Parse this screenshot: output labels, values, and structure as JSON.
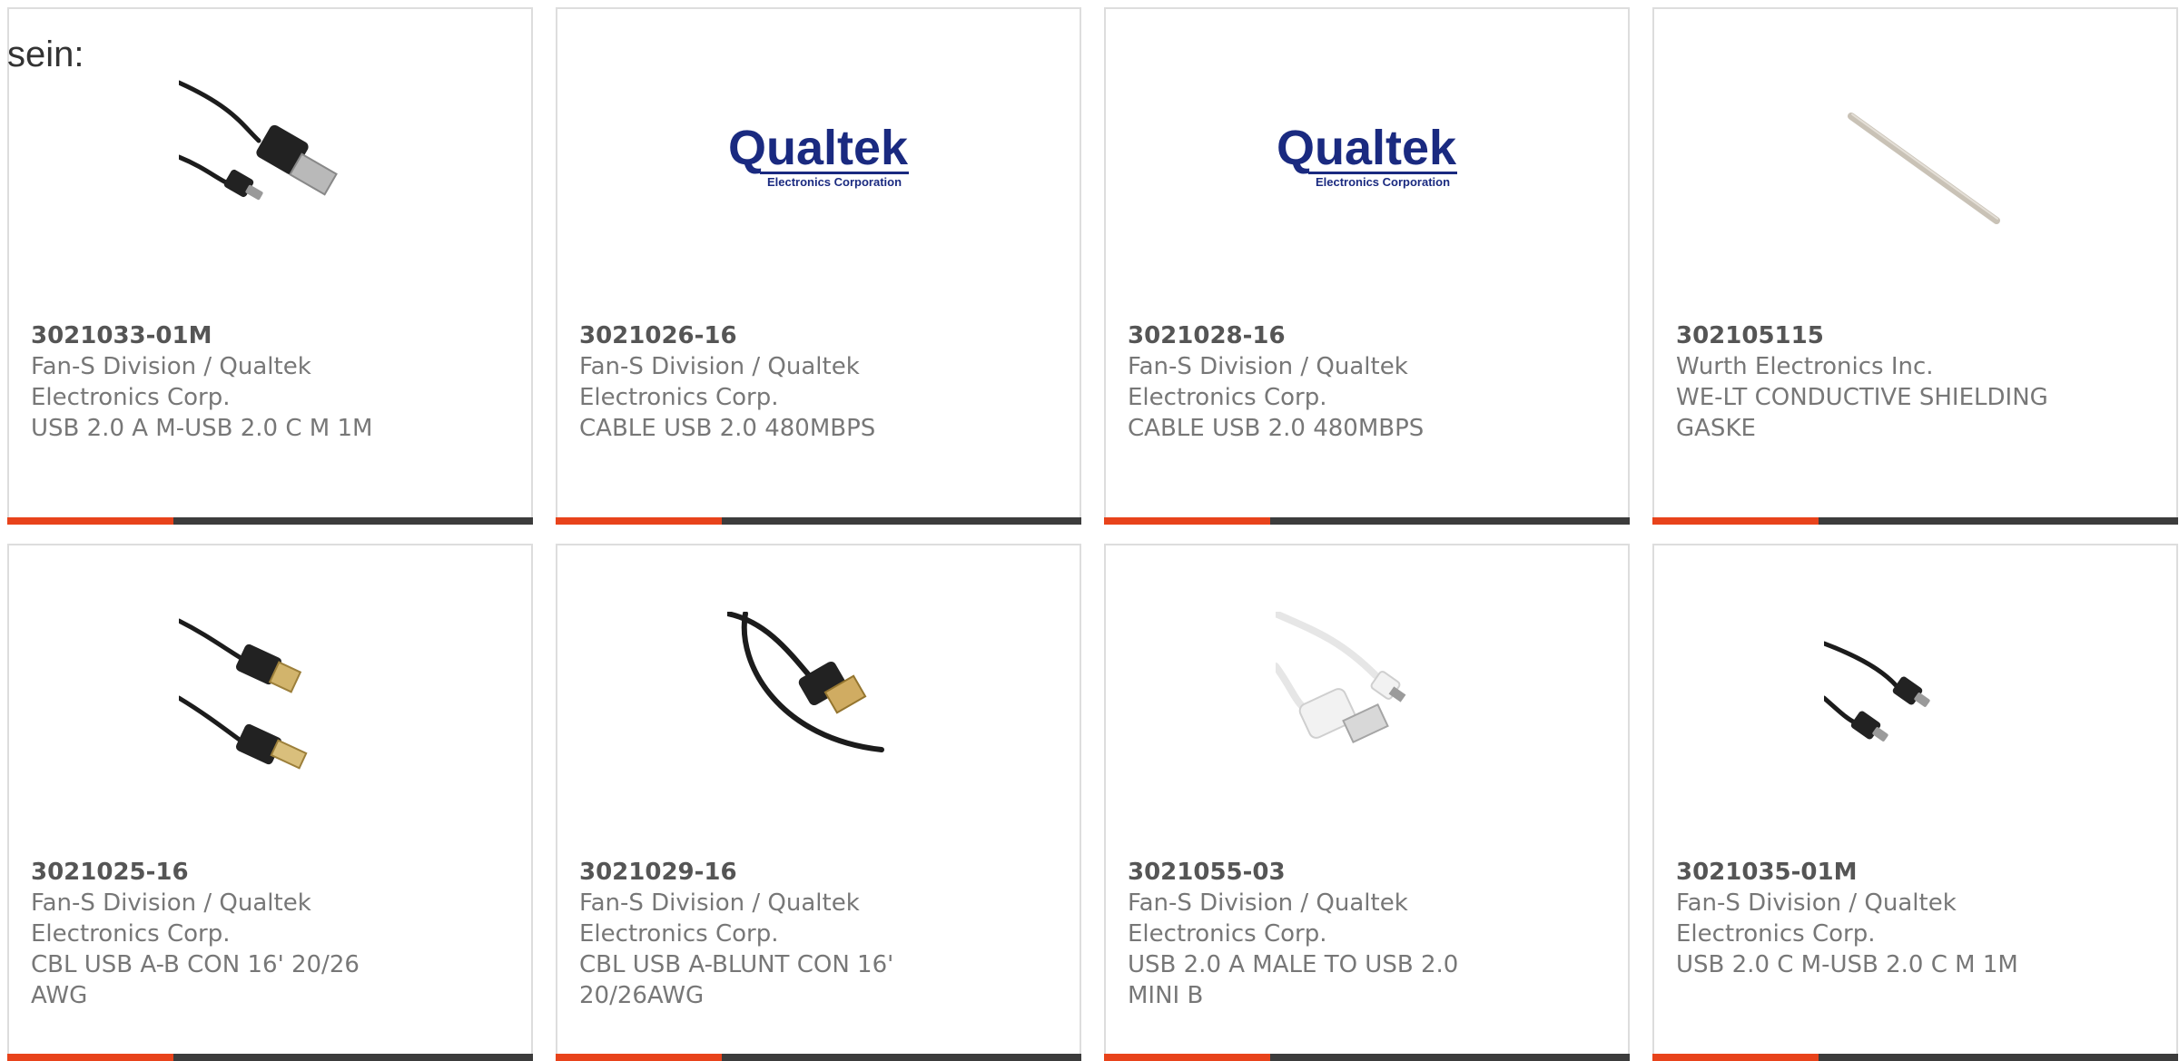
{
  "intro_text": "sein:",
  "products": [
    {
      "part_number": "3021033-01M",
      "manufacturer": "Fan-S Division / Qualtek Electronics Corp.",
      "description": "USB 2.0 A M-USB 2.0 C M 1M",
      "image": "usb-a-to-usb-c-cable-icon"
    },
    {
      "part_number": "3021026-16",
      "manufacturer": "Fan-S Division / Qualtek Electronics Corp.",
      "description": "CABLE USB 2.0 480MBPS",
      "image": "qualtek-logo",
      "logo": {
        "name": "Qualtek",
        "tagline": "Electronics Corporation"
      }
    },
    {
      "part_number": "3021028-16",
      "manufacturer": "Fan-S Division / Qualtek Electronics Corp.",
      "description": "CABLE USB 2.0 480MBPS",
      "image": "qualtek-logo",
      "logo": {
        "name": "Qualtek",
        "tagline": "Electronics Corporation"
      }
    },
    {
      "part_number": "302105115",
      "manufacturer": "Wurth Electronics Inc.",
      "description": "WE-LT CONDUCTIVE SHIELDING GASKE",
      "image": "shielding-gasket-strip-icon"
    },
    {
      "part_number": "3021025-16",
      "manufacturer": "Fan-S Division / Qualtek Electronics Corp.",
      "description": "CBL USB A-B CON 16' 20/26 AWG",
      "image": "usb-a-to-usb-b-cable-icon"
    },
    {
      "part_number": "3021029-16",
      "manufacturer": "Fan-S Division / Qualtek Electronics Corp.",
      "description": "CBL USB A-BLUNT CON 16' 20/26AWG",
      "image": "usb-a-blunt-cable-icon"
    },
    {
      "part_number": "3021055-03",
      "manufacturer": "Fan-S Division / Qualtek Electronics Corp.",
      "description": "USB 2.0 A MALE TO USB 2.0 MINI B",
      "image": "usb-a-to-mini-b-cable-icon"
    },
    {
      "part_number": "3021035-01M",
      "manufacturer": "Fan-S Division / Qualtek Electronics Corp.",
      "description": "USB 2.0 C M-USB 2.0 C M 1M",
      "image": "usb-c-to-usb-c-cable-icon"
    }
  ],
  "colors": {
    "accent": "#e8431b",
    "bar": "#3c3c3c",
    "logo_blue": "#1a2a80"
  }
}
